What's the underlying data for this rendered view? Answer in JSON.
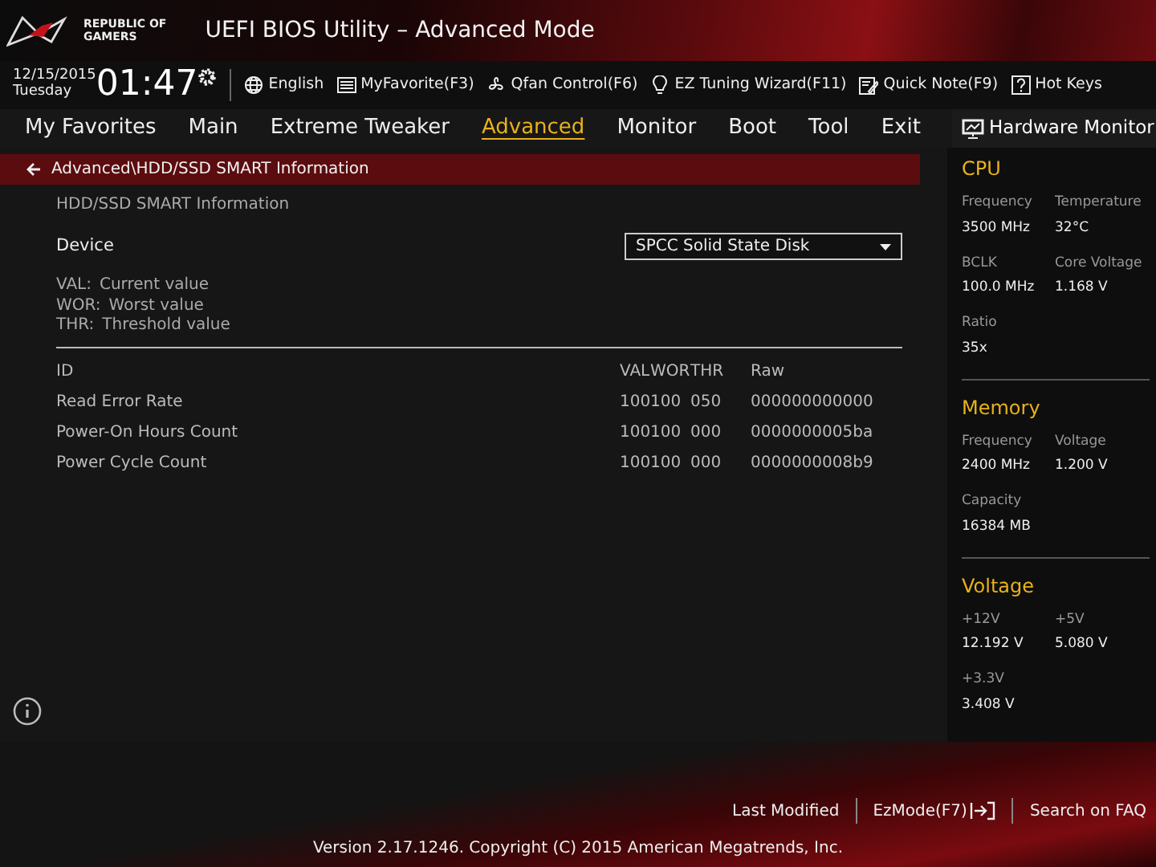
{
  "header": {
    "brand_line1": "REPUBLIC OF",
    "brand_line2": "GAMERS",
    "title": "UEFI BIOS Utility – Advanced Mode"
  },
  "toolbar": {
    "date": "12/15/2015",
    "day": "Tuesday",
    "time": "01:47",
    "items": [
      {
        "kind": "globe",
        "label": "English"
      },
      {
        "kind": "favorite",
        "label": "MyFavorite(F3)"
      },
      {
        "kind": "fan",
        "label": "Qfan Control(F6)"
      },
      {
        "kind": "bulb",
        "label": "EZ Tuning Wizard(F11)"
      },
      {
        "kind": "note",
        "label": "Quick Note(F9)"
      },
      {
        "kind": "help",
        "label": "Hot Keys"
      }
    ]
  },
  "tabs": [
    {
      "label": "My Favorites",
      "selected": false
    },
    {
      "label": "Main",
      "selected": false
    },
    {
      "label": "Extreme Tweaker",
      "selected": false
    },
    {
      "label": "Advanced",
      "selected": true
    },
    {
      "label": "Monitor",
      "selected": false
    },
    {
      "label": "Boot",
      "selected": false
    },
    {
      "label": "Tool",
      "selected": false
    },
    {
      "label": "Exit",
      "selected": false
    }
  ],
  "breadcrumb": "Advanced\\HDD/SSD SMART Information",
  "section_title": "HDD/SSD SMART Information",
  "device": {
    "label": "Device",
    "value": "SPCC Solid State Disk"
  },
  "legend": [
    {
      "abbr": "VAL:",
      "text": "Current value"
    },
    {
      "abbr": "WOR:",
      "text": "Worst value"
    },
    {
      "abbr": "THR:",
      "text": "Threshold value"
    }
  ],
  "table": {
    "columns": [
      "ID",
      "VAL",
      "WOR",
      "THR",
      "Raw"
    ],
    "rows": [
      [
        "Read Error Rate",
        "100",
        "100",
        "050",
        "000000000000"
      ],
      [
        "Power-On Hours Count",
        "100",
        "100",
        "000",
        "0000000005ba"
      ],
      [
        "Power Cycle Count",
        "100",
        "100",
        "000",
        "0000000008b9"
      ]
    ]
  },
  "hardware_monitor": {
    "title": "Hardware Monitor",
    "sections": [
      {
        "title": "CPU",
        "items": [
          {
            "label": "Frequency",
            "value": "3500 MHz"
          },
          {
            "label": "Temperature",
            "value": "32°C"
          },
          {
            "label": "BCLK",
            "value": "100.0 MHz"
          },
          {
            "label": "Core Voltage",
            "value": "1.168 V"
          },
          {
            "label": "Ratio",
            "value": "35x"
          }
        ]
      },
      {
        "title": "Memory",
        "items": [
          {
            "label": "Frequency",
            "value": "2400 MHz"
          },
          {
            "label": "Voltage",
            "value": "1.200 V"
          },
          {
            "label": "Capacity",
            "value": "16384 MB"
          }
        ]
      },
      {
        "title": "Voltage",
        "items": [
          {
            "label": "+12V",
            "value": "12.192 V"
          },
          {
            "label": "+5V",
            "value": "5.080 V"
          },
          {
            "label": "+3.3V",
            "value": "3.408 V"
          }
        ]
      }
    ]
  },
  "footer": {
    "links": [
      {
        "kind": "text",
        "label": "Last Modified"
      },
      {
        "kind": "exit",
        "label": "EzMode(F7)"
      },
      {
        "kind": "text",
        "label": "Search on FAQ"
      }
    ],
    "version": "Version 2.17.1246. Copyright (C) 2015 American Megatrends, Inc."
  }
}
